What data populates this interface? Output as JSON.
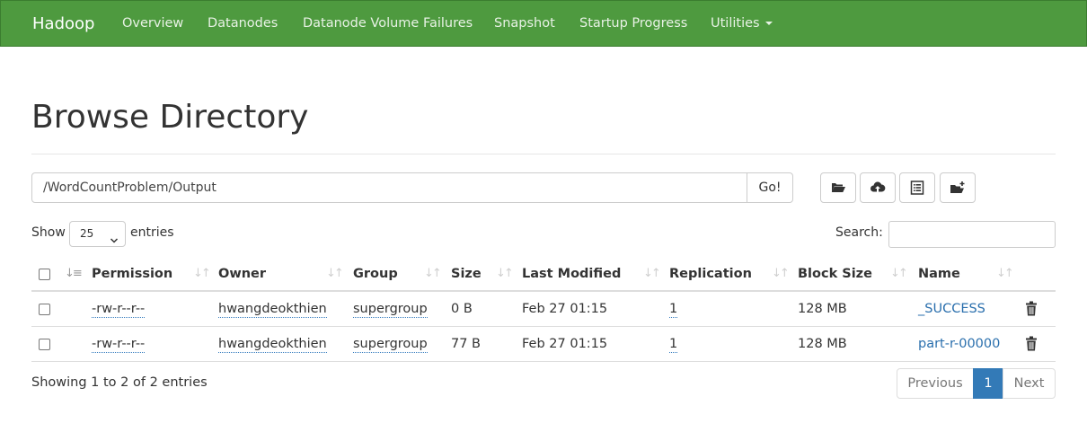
{
  "navbar": {
    "brand": "Hadoop",
    "items": [
      "Overview",
      "Datanodes",
      "Datanode Volume Failures",
      "Snapshot",
      "Startup Progress",
      "Utilities"
    ],
    "bg_color": "#4e9a3f"
  },
  "page_title": "Browse Directory",
  "path_bar": {
    "value": "/WordCountProblem/Output",
    "go_label": "Go!"
  },
  "toolbar_icons": [
    "folder-open-icon",
    "cloud-upload-icon",
    "list-alt-icon",
    "folder-add-icon"
  ],
  "length_control": {
    "show_label": "Show",
    "selected": "25",
    "entries_label": "entries"
  },
  "search": {
    "label": "Search:",
    "value": ""
  },
  "table": {
    "columns": [
      "Permission",
      "Owner",
      "Group",
      "Size",
      "Last Modified",
      "Replication",
      "Block Size",
      "Name"
    ],
    "rows": [
      {
        "permission": "-rw-r--r--",
        "owner": "hwangdeokthien",
        "group": "supergroup",
        "size": "0 B",
        "last_modified": "Feb 27 01:15",
        "replication": "1",
        "block_size": "128 MB",
        "name": "_SUCCESS"
      },
      {
        "permission": "-rw-r--r--",
        "owner": "hwangdeokthien",
        "group": "supergroup",
        "size": "77 B",
        "last_modified": "Feb 27 01:15",
        "replication": "1",
        "block_size": "128 MB",
        "name": "part-r-00000"
      }
    ]
  },
  "footer": {
    "info": "Showing 1 to 2 of 2 entries",
    "pagination": {
      "previous": "Previous",
      "current": "1",
      "next": "Next"
    }
  },
  "colors": {
    "accent": "#337ab7",
    "link": "#2a6fad"
  }
}
